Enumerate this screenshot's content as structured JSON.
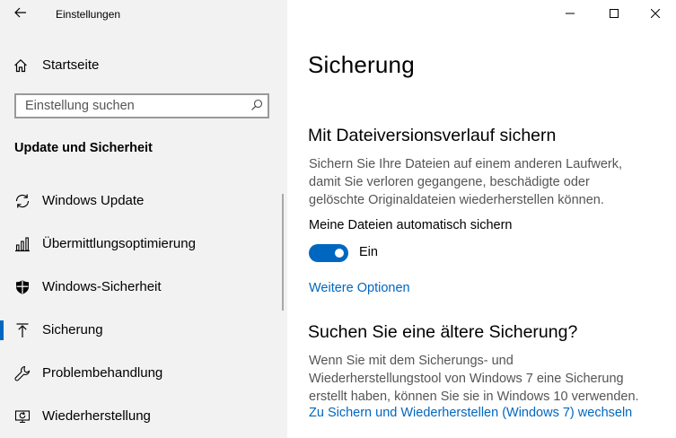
{
  "window": {
    "title": "Einstellungen",
    "back_icon": "arrow-left-icon",
    "controls": [
      "minimize-icon",
      "maximize-icon",
      "close-icon"
    ]
  },
  "sidebar": {
    "home_label": "Startseite",
    "home_icon": "home-icon",
    "search_placeholder": "Einstellung suchen",
    "search_icon": "search-icon",
    "section_title": "Update und Sicherheit",
    "items": [
      {
        "label": "Windows Update",
        "icon": "refresh-icon",
        "selected": false
      },
      {
        "label": "Übermittlungsoptimierung",
        "icon": "delivery-optimization-icon",
        "selected": false
      },
      {
        "label": "Windows-Sicherheit",
        "icon": "shield-icon",
        "selected": false
      },
      {
        "label": "Sicherung",
        "icon": "backup-arrow-icon",
        "selected": true
      },
      {
        "label": "Problembehandlung",
        "icon": "wrench-icon",
        "selected": false
      },
      {
        "label": "Wiederherstellung",
        "icon": "recovery-icon",
        "selected": false
      }
    ],
    "accent_color": "#0067c0"
  },
  "main": {
    "page_title": "Sicherung",
    "file_history": {
      "heading": "Mit Dateiversionsverlauf sichern",
      "description": [
        "Sichern Sie Ihre Dateien auf einem anderen Laufwerk,",
        "damit Sie verloren gegangene, beschädigte oder",
        "gelöschte Originaldateien wiederherstellen können."
      ],
      "toggle_label": "Meine Dateien automatisch sichern",
      "toggle_state": "Ein",
      "toggle_on": true,
      "more_options_link": "Weitere Optionen"
    },
    "older_backup": {
      "heading": "Suchen Sie eine ältere Sicherung?",
      "description": [
        "Wenn Sie mit dem Sicherungs- und",
        "Wiederherstellungstool von Windows 7 eine Sicherung",
        "erstellt haben, können Sie sie in Windows 10 verwenden."
      ],
      "link": "Zu Sichern und Wiederherstellen (Windows 7) wechseln"
    }
  }
}
